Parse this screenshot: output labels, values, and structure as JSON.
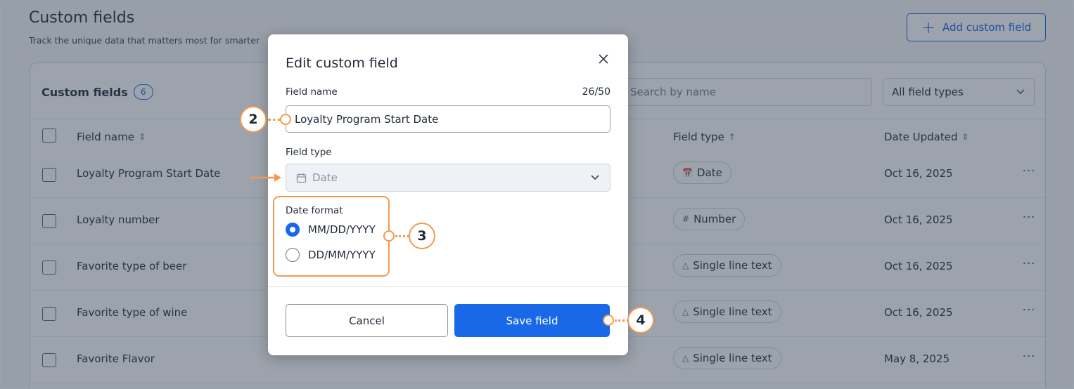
{
  "page": {
    "title": "Custom fields",
    "subtitle": "Track the unique data that matters most for smarter",
    "add_button": "Add custom field"
  },
  "table": {
    "title": "Custom fields",
    "count": "6",
    "search_placeholder": "Search by name",
    "filter_value": "All field types",
    "columns": {
      "name": "Field name",
      "type": "Field type",
      "date": "Date Updated"
    },
    "rows": [
      {
        "name": "Loyalty Program Start Date",
        "type": "Date",
        "type_icon": "calendar-icon",
        "date": "Oct 16, 2025"
      },
      {
        "name": "Loyalty number",
        "type": "Number",
        "type_icon": "hash-icon",
        "date": "Oct 16, 2025"
      },
      {
        "name": "Favorite type of beer",
        "type": "Single line text",
        "type_icon": "text-icon",
        "date": "Oct 16, 2025"
      },
      {
        "name": "Favorite type of wine",
        "type": "Single line text",
        "type_icon": "text-icon",
        "date": "Oct 16, 2025"
      },
      {
        "name": "Favorite Flavor",
        "type": "Single line text",
        "type_icon": "text-icon",
        "date": "May 8, 2025"
      }
    ]
  },
  "modal": {
    "title": "Edit custom field",
    "field_name_label": "Field name",
    "char_count": "26/50",
    "field_name_value": "Loyalty Program Start Date",
    "field_type_label": "Field type",
    "field_type_value": "Date",
    "date_format_label": "Date format",
    "formats": [
      {
        "label": "MM/DD/YYYY",
        "selected": true
      },
      {
        "label": "DD/MM/YYYY",
        "selected": false
      }
    ],
    "cancel_label": "Cancel",
    "save_label": "Save field"
  },
  "annotations": {
    "step2": "2",
    "step3": "3",
    "step4": "4"
  },
  "colors": {
    "accent": "#1868e8",
    "annotation": "#f39a50"
  }
}
